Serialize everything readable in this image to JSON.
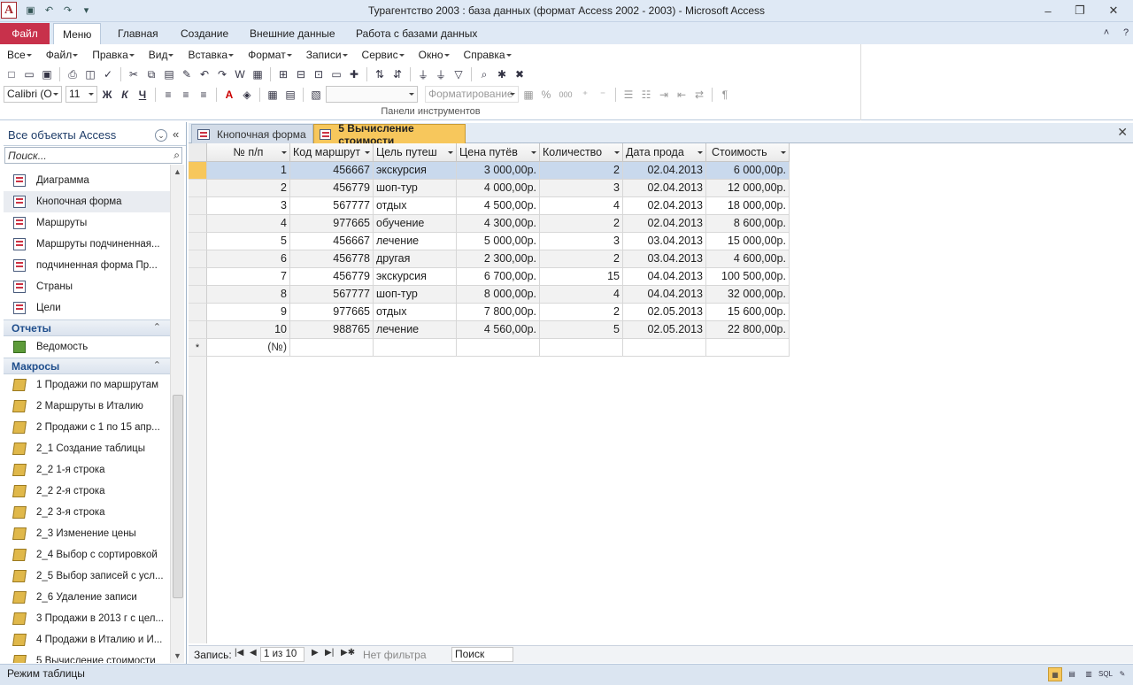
{
  "window": {
    "title": "Турагентство 2003 : база данных (формат Access 2002 - 2003)  -  Microsoft Access",
    "app_icon": "A"
  },
  "ribbon_tabs": {
    "file": "Файл",
    "items": [
      "Меню",
      "Главная",
      "Создание",
      "Внешние данные",
      "Работа с базами данных"
    ],
    "active": "Меню"
  },
  "menubar": [
    "Все",
    "Файл",
    "Правка",
    "Вид",
    "Вставка",
    "Формат",
    "Записи",
    "Сервис",
    "Окно",
    "Справка"
  ],
  "toolbar": {
    "font_name": "Calibri (О",
    "font_size": "11",
    "bold": "Ж",
    "italic": "К",
    "underline": "Ч",
    "format_label": "Форматирование",
    "group_label": "Панели инструментов",
    "percent": "%",
    "thousands": "000"
  },
  "nav": {
    "header": "Все объекты Access",
    "search_placeholder": "Поиск...",
    "forms": [
      "Диаграмма",
      "Кнопочная форма",
      "Маршруты",
      "Маршруты подчиненная...",
      "подчиненная форма Пр..."
    ],
    "forms_more": [
      "Страны",
      "Цели"
    ],
    "reports_header": "Отчеты",
    "reports": [
      "Ведомость"
    ],
    "macros_header": "Макросы",
    "macros": [
      "1 Продажи по маршрутам",
      "2 Маршруты в Италию",
      "2 Продажи с 1 по 15 апр...",
      "2_1 Создание таблицы",
      "2_2 1-я строка",
      "2_2 2-я строка",
      "2_2 3-я строка",
      "2_3 Изменение цены",
      "2_4 Выбор с сортировкой",
      "2_5 Выбор записей с усл...",
      "2_6 Удаление  записи",
      "3 Продажи в 2013 г с цел...",
      "4 Продажи в Италию и И...",
      "5 Вычисление стоимости"
    ]
  },
  "doc_tabs": [
    {
      "label": "Кнопочная форма"
    },
    {
      "label": "5 Вычисление стоимости"
    }
  ],
  "table": {
    "columns": [
      "№ п/п",
      "Код маршрут",
      "Цель путеш",
      "Цена путёв",
      "Количество",
      "Дата прода",
      "Стоимость"
    ],
    "rows": [
      [
        "1",
        "456667",
        "экскурсия",
        "3 000,00р.",
        "2",
        "02.04.2013",
        "6 000,00р."
      ],
      [
        "2",
        "456779",
        "шоп-тур",
        "4 000,00р.",
        "3",
        "02.04.2013",
        "12 000,00р."
      ],
      [
        "3",
        "567777",
        "отдых",
        "4 500,00р.",
        "4",
        "02.04.2013",
        "18 000,00р."
      ],
      [
        "4",
        "977665",
        "обучение",
        "4 300,00р.",
        "2",
        "02.04.2013",
        "8 600,00р."
      ],
      [
        "5",
        "456667",
        "лечение",
        "5 000,00р.",
        "3",
        "03.04.2013",
        "15 000,00р."
      ],
      [
        "6",
        "456778",
        "другая",
        "2 300,00р.",
        "2",
        "03.04.2013",
        "4 600,00р."
      ],
      [
        "7",
        "456779",
        "экскурсия",
        "6 700,00р.",
        "15",
        "04.04.2013",
        "100 500,00р."
      ],
      [
        "8",
        "567777",
        "шоп-тур",
        "8 000,00р.",
        "4",
        "04.04.2013",
        "32 000,00р."
      ],
      [
        "9",
        "977665",
        "отдых",
        "7 800,00р.",
        "2",
        "02.05.2013",
        "15 600,00р."
      ],
      [
        "10",
        "988765",
        "лечение",
        "4 560,00р.",
        "5",
        "02.05.2013",
        "22 800,00р."
      ]
    ],
    "new_row_marker": "*",
    "new_row_value": "(№)"
  },
  "record_nav": {
    "label": "Запись:",
    "position": "1 из 10",
    "filter": "Нет фильтра",
    "search": "Поиск"
  },
  "status": {
    "mode": "Режим таблицы",
    "sql": "SQL"
  },
  "colors": {
    "file_tab": "#c8314b",
    "active_doc_tab": "#f7c75c",
    "current_row": "#c9d9ed"
  }
}
